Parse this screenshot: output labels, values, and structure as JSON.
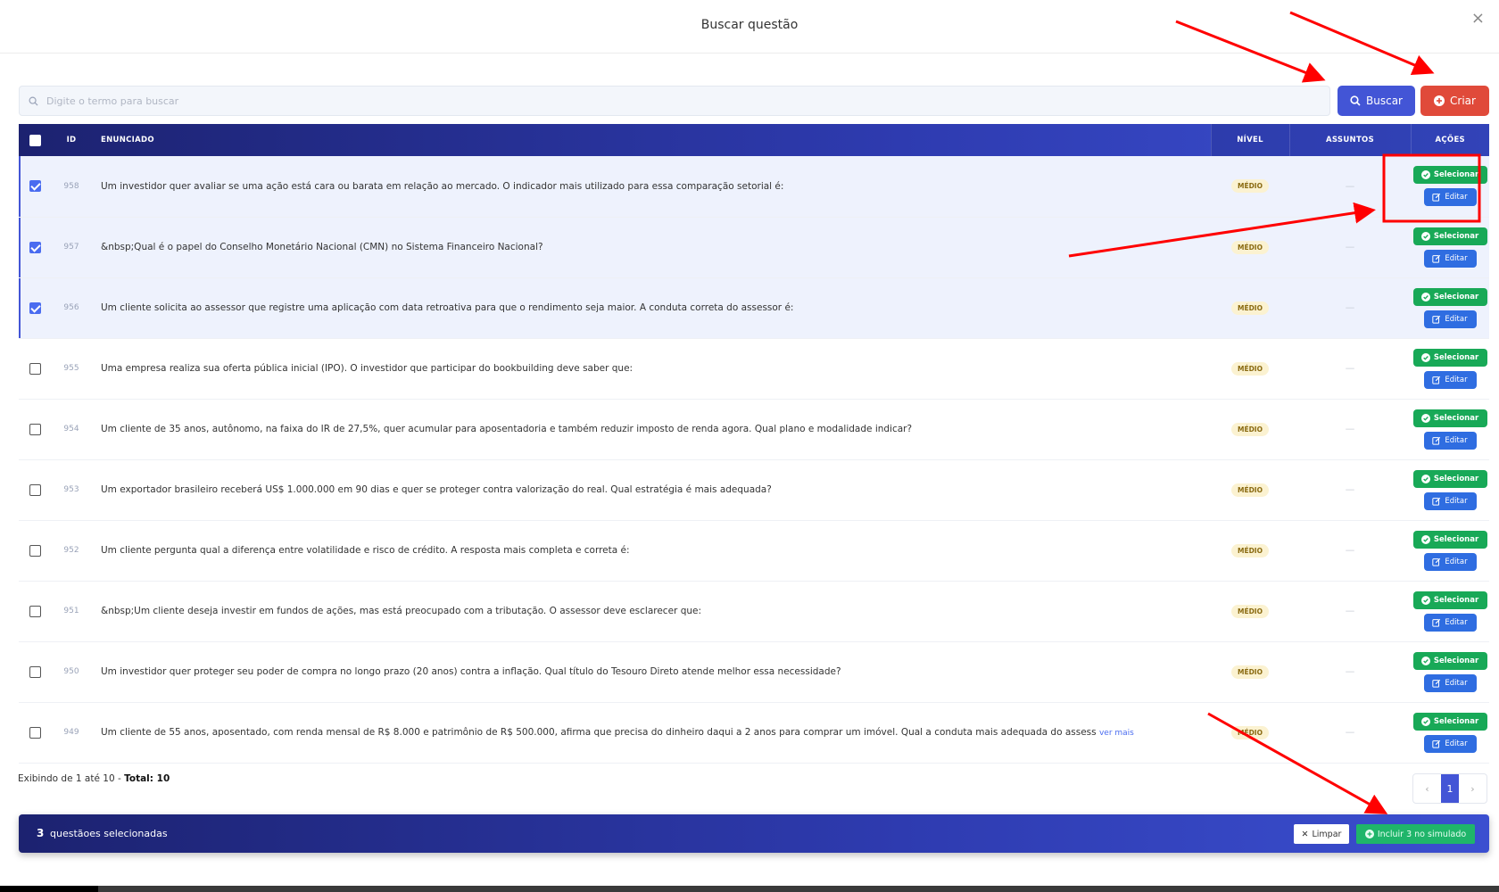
{
  "header": {
    "title": "Buscar questão",
    "close": "×"
  },
  "search": {
    "placeholder": "Digite o termo para buscar",
    "buscar_label": "Buscar",
    "criar_label": "Criar"
  },
  "table": {
    "columns": {
      "id": "ID",
      "enunciado": "ENUNCIADO",
      "nivel": "NÍVEL",
      "assuntos": "ASSUNTOS",
      "acoes": "AÇÕES"
    },
    "rows": [
      {
        "id": "958",
        "checked": true,
        "enunciado": "Um investidor quer avaliar se uma ação está cara ou barata em relação ao mercado. O indicador mais utilizado para essa comparação setorial é:",
        "nivel": "MÉDIO",
        "assuntos": "—",
        "more": ""
      },
      {
        "id": "957",
        "checked": true,
        "enunciado": "&nbsp;Qual é o papel do Conselho Monetário Nacional (CMN) no Sistema Financeiro Nacional?",
        "nivel": "MÉDIO",
        "assuntos": "—",
        "more": ""
      },
      {
        "id": "956",
        "checked": true,
        "enunciado": "Um cliente solicita ao assessor que registre uma aplicação com data retroativa para que o rendimento seja maior. A conduta correta do assessor é:",
        "nivel": "MÉDIO",
        "assuntos": "—",
        "more": ""
      },
      {
        "id": "955",
        "checked": false,
        "enunciado": "Uma empresa realiza sua oferta pública inicial (IPO). O investidor que participar do bookbuilding deve saber que:",
        "nivel": "MÉDIO",
        "assuntos": "—",
        "more": ""
      },
      {
        "id": "954",
        "checked": false,
        "enunciado": "Um cliente de 35 anos, autônomo, na faixa do IR de 27,5%, quer acumular para aposentadoria e também reduzir imposto de renda agora. Qual plano e modalidade indicar?",
        "nivel": "MÉDIO",
        "assuntos": "—",
        "more": ""
      },
      {
        "id": "953",
        "checked": false,
        "enunciado": "Um exportador brasileiro receberá US$ 1.000.000 em 90 dias e quer se proteger contra valorização do real. Qual estratégia é mais adequada?",
        "nivel": "MÉDIO",
        "assuntos": "—",
        "more": ""
      },
      {
        "id": "952",
        "checked": false,
        "enunciado": "Um cliente pergunta qual a diferença entre volatilidade e risco de crédito. A resposta mais completa e correta é:",
        "nivel": "MÉDIO",
        "assuntos": "—",
        "more": ""
      },
      {
        "id": "951",
        "checked": false,
        "enunciado": "&nbsp;Um cliente deseja investir em fundos de ações, mas está preocupado com a tributação. O assessor deve esclarecer que:",
        "nivel": "MÉDIO",
        "assuntos": "—",
        "more": ""
      },
      {
        "id": "950",
        "checked": false,
        "enunciado": "Um investidor quer proteger seu poder de compra no longo prazo (20 anos) contra a inflação. Qual título do Tesouro Direto atende melhor essa necessidade?",
        "nivel": "MÉDIO",
        "assuntos": "—",
        "more": ""
      },
      {
        "id": "949",
        "checked": false,
        "enunciado": "Um cliente de 55 anos, aposentado, com renda mensal de R$ 8.000 e patrimônio de R$ 500.000, afirma que precisa do dinheiro daqui a 2 anos para comprar um imóvel. Qual a conduta mais adequada do assess",
        "nivel": "MÉDIO",
        "assuntos": "—",
        "more": "ver mais"
      }
    ],
    "actions": {
      "select_label": "Selecionar",
      "edit_label": "Editar"
    }
  },
  "footer": {
    "showing": "Exibindo de 1 até 10 - ",
    "total": "Total: 10"
  },
  "pagination": {
    "prev": "‹",
    "current": "1",
    "next": "›"
  },
  "selection_bar": {
    "count": "3",
    "label": "questãoes selecionadas",
    "clear_label": "Limpar",
    "include_label": "Incluir 3 no simulado"
  },
  "colors": {
    "primary": "#4355d6",
    "danger": "#e04a3a",
    "success": "#18a957",
    "edit": "#2f6de1",
    "annotation": "#ff0000"
  }
}
